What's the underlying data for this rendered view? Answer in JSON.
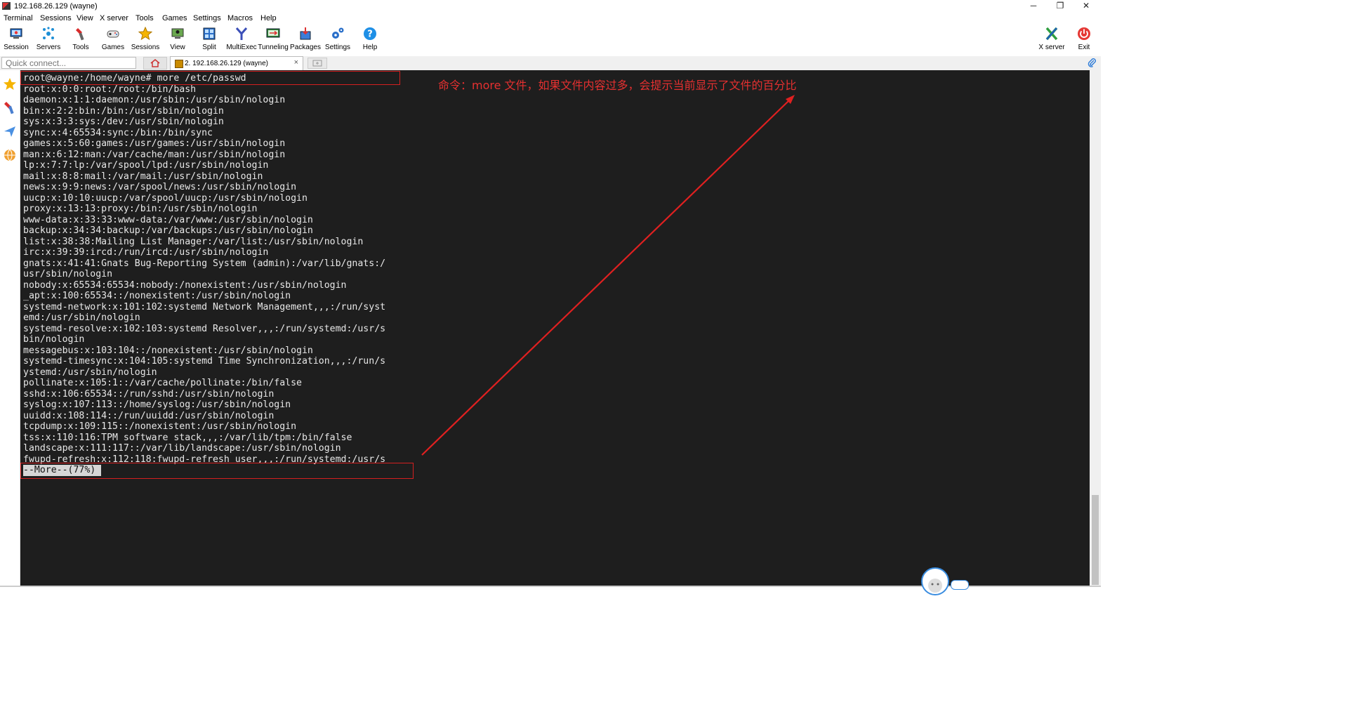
{
  "window": {
    "title": "192.168.26.129 (wayne)",
    "controls": {
      "minimize": "─",
      "restore": "❐",
      "close": "✕"
    }
  },
  "menu": [
    "Terminal",
    "Sessions",
    "View",
    "X server",
    "Tools",
    "Games",
    "Settings",
    "Macros",
    "Help"
  ],
  "toolbar": {
    "items": [
      {
        "label": "Session",
        "icon": "session-icon"
      },
      {
        "label": "Servers",
        "icon": "servers-icon"
      },
      {
        "label": "Tools",
        "icon": "tools-icon"
      },
      {
        "label": "Games",
        "icon": "games-icon"
      },
      {
        "label": "Sessions",
        "icon": "sessions-star-icon"
      },
      {
        "label": "View",
        "icon": "view-icon"
      },
      {
        "label": "Split",
        "icon": "split-icon"
      },
      {
        "label": "MultiExec",
        "icon": "multiexec-icon"
      },
      {
        "label": "Tunneling",
        "icon": "tunneling-icon"
      },
      {
        "label": "Packages",
        "icon": "packages-icon"
      },
      {
        "label": "Settings",
        "icon": "settings-icon"
      },
      {
        "label": "Help",
        "icon": "help-icon"
      }
    ],
    "right": [
      {
        "label": "X server",
        "icon": "x-server-icon"
      },
      {
        "label": "Exit",
        "icon": "exit-icon"
      }
    ]
  },
  "tabs": {
    "quick_connect_placeholder": "Quick connect...",
    "session_tab": "2. 192.168.26.129 (wayne)",
    "close_glyph": "×"
  },
  "terminal": {
    "command_line": "root@wayne:/home/wayne# more /etc/passwd",
    "lines": [
      "root:x:0:0:root:/root:/bin/bash",
      "daemon:x:1:1:daemon:/usr/sbin:/usr/sbin/nologin",
      "bin:x:2:2:bin:/bin:/usr/sbin/nologin",
      "sys:x:3:3:sys:/dev:/usr/sbin/nologin",
      "sync:x:4:65534:sync:/bin:/bin/sync",
      "games:x:5:60:games:/usr/games:/usr/sbin/nologin",
      "man:x:6:12:man:/var/cache/man:/usr/sbin/nologin",
      "lp:x:7:7:lp:/var/spool/lpd:/usr/sbin/nologin",
      "mail:x:8:8:mail:/var/mail:/usr/sbin/nologin",
      "news:x:9:9:news:/var/spool/news:/usr/sbin/nologin",
      "uucp:x:10:10:uucp:/var/spool/uucp:/usr/sbin/nologin",
      "proxy:x:13:13:proxy:/bin:/usr/sbin/nologin",
      "www-data:x:33:33:www-data:/var/www:/usr/sbin/nologin",
      "backup:x:34:34:backup:/var/backups:/usr/sbin/nologin",
      "list:x:38:38:Mailing List Manager:/var/list:/usr/sbin/nologin",
      "irc:x:39:39:ircd:/run/ircd:/usr/sbin/nologin",
      "gnats:x:41:41:Gnats Bug-Reporting System (admin):/var/lib/gnats:/",
      "usr/sbin/nologin",
      "nobody:x:65534:65534:nobody:/nonexistent:/usr/sbin/nologin",
      "_apt:x:100:65534::/nonexistent:/usr/sbin/nologin",
      "systemd-network:x:101:102:systemd Network Management,,,:/run/syst",
      "emd:/usr/sbin/nologin",
      "systemd-resolve:x:102:103:systemd Resolver,,,:/run/systemd:/usr/s",
      "bin/nologin",
      "messagebus:x:103:104::/nonexistent:/usr/sbin/nologin",
      "systemd-timesync:x:104:105:systemd Time Synchronization,,,:/run/s",
      "ystemd:/usr/sbin/nologin",
      "pollinate:x:105:1::/var/cache/pollinate:/bin/false",
      "sshd:x:106:65534::/run/sshd:/usr/sbin/nologin",
      "syslog:x:107:113::/home/syslog:/usr/sbin/nologin",
      "uuidd:x:108:114::/run/uuidd:/usr/sbin/nologin",
      "tcpdump:x:109:115::/nonexistent:/usr/sbin/nologin",
      "tss:x:110:116:TPM software stack,,,:/var/lib/tpm:/bin/false",
      "landscape:x:111:117::/var/lib/landscape:/usr/sbin/nologin",
      "fwupd-refresh:x:112:118:fwupd-refresh user,,,:/run/systemd:/usr/s"
    ],
    "more_prompt": "--More--(77%)",
    "annotation": "命令：more 文件，如果文件内容过多，会提示当前显示了文件的百分比",
    "annotation_color": "#e53030",
    "background": "#1e1e1e"
  },
  "sidebar_icons": [
    "star-icon",
    "tools-side-icon",
    "send-icon",
    "globe-icon"
  ]
}
